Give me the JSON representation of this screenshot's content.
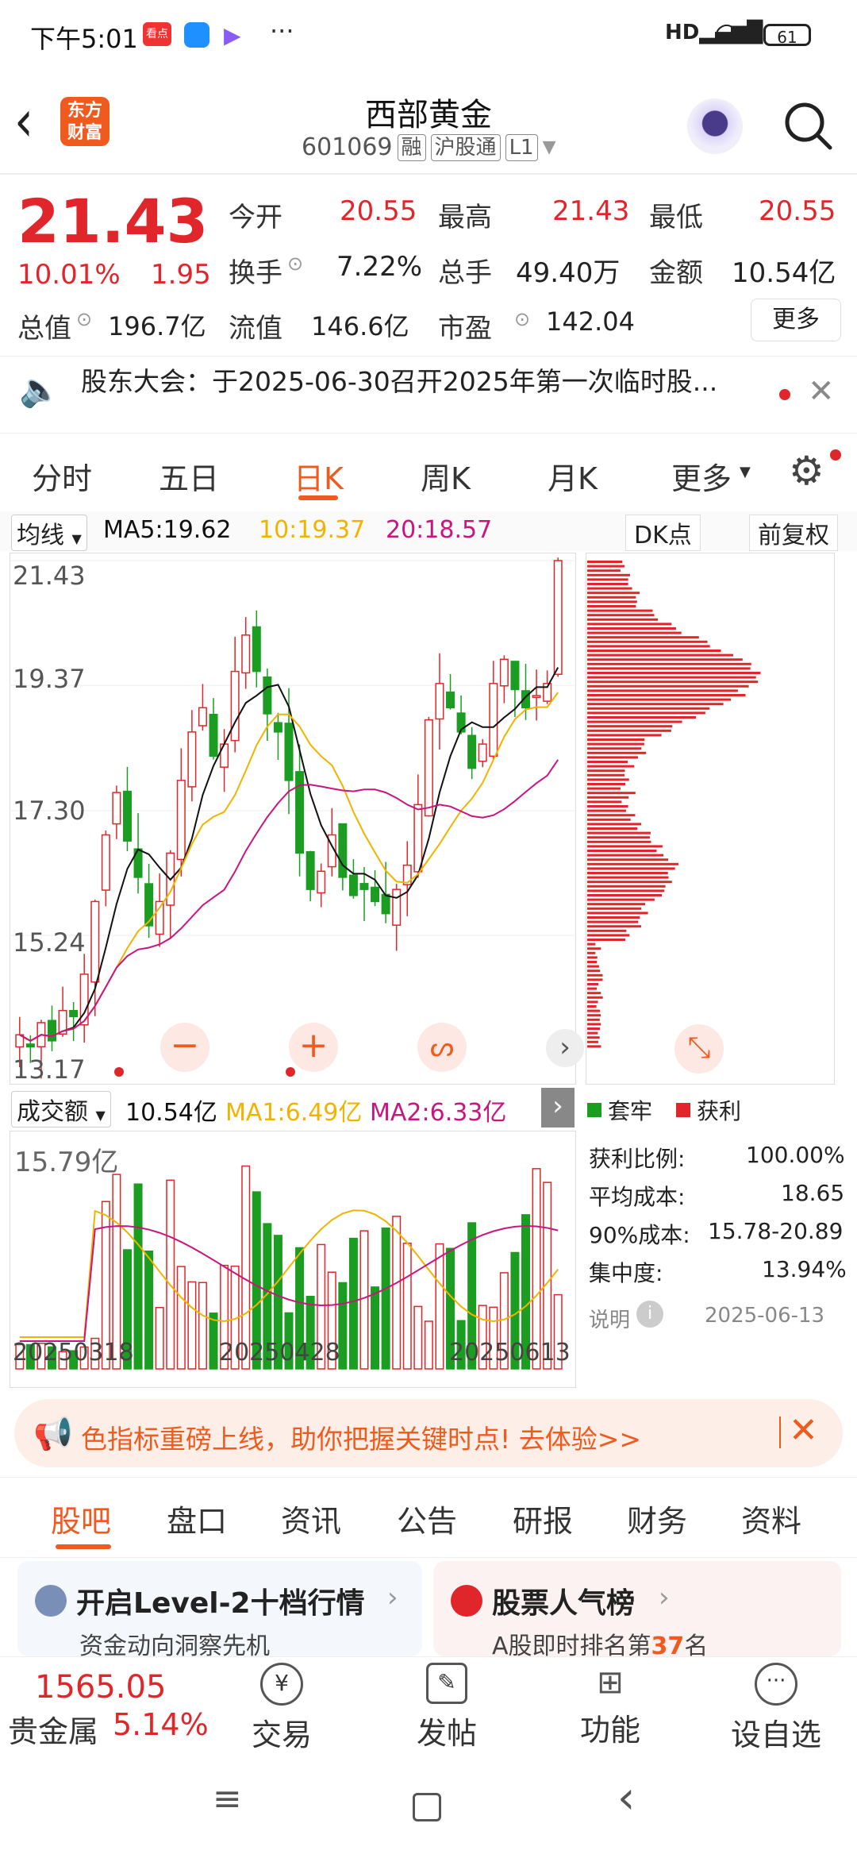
{
  "status_bar": {
    "time": "下午5:01",
    "app_badge": "看点",
    "battery": "61"
  },
  "header": {
    "logo_line1": "东方",
    "logo_line2": "财富",
    "title": "西部黄金",
    "code": "601069",
    "tags": [
      "融",
      "沪股通",
      "L1"
    ]
  },
  "quote": {
    "price": "21.43",
    "change_pct": "10.01%",
    "change": "1.95",
    "fields": [
      {
        "label": "今开",
        "value": "20.55"
      },
      {
        "label": "最高",
        "value": "21.43"
      },
      {
        "label": "最低",
        "value": "20.55"
      },
      {
        "label": "换手",
        "value": "7.22%"
      },
      {
        "label": "总手",
        "value": "49.40万"
      },
      {
        "label": "金额",
        "value": "10.54亿"
      },
      {
        "label": "总值",
        "value": "196.7亿"
      },
      {
        "label": "流值",
        "value": "146.6亿"
      },
      {
        "label": "市盈",
        "value": "142.04"
      }
    ],
    "more_button": "更多"
  },
  "notice": {
    "text": "股东大会：于2025-06-30召开2025年第一次临时股..."
  },
  "ktabs": [
    "分时",
    "五日",
    "日K",
    "周K",
    "月K",
    "更多"
  ],
  "active_ktab": "日K",
  "indicator": {
    "ma_select": "均线",
    "ma5": "MA5:19.62",
    "ma10": "10:19.37",
    "ma20": "20:18.57",
    "dk": "DK点",
    "adjust": "前复权"
  },
  "price_axis": [
    "21.43",
    "19.37",
    "17.30",
    "15.24",
    "13.17"
  ],
  "volume": {
    "select": "成交额",
    "amount": "10.54亿",
    "ma1": "MA1:6.49亿",
    "ma2": "MA2:6.33亿",
    "axis_max": "15.79亿"
  },
  "dates": [
    "20250318",
    "20250428",
    "20250613"
  ],
  "chip": {
    "legend_loss": "套牢",
    "legend_profit": "获利",
    "rows": [
      {
        "label": "获利比例:",
        "value": "100.00%"
      },
      {
        "label": "平均成本:",
        "value": "18.65"
      },
      {
        "label": "90%成本:",
        "value": "15.78-20.89"
      },
      {
        "label": "集中度:",
        "value": "13.94%"
      }
    ],
    "explain": "说明",
    "date": "2025-06-13"
  },
  "promo": {
    "text": "色指标重磅上线，助你把握关键时点! 去体验>>"
  },
  "bottom_tabs": [
    "股吧",
    "盘口",
    "资讯",
    "公告",
    "研报",
    "财务",
    "资料"
  ],
  "active_bottom_tab": "股吧",
  "cards": [
    {
      "title": "开启Level-2十档行情",
      "sub": "资金动向洞察先机"
    },
    {
      "title": "股票人气榜",
      "sub_prefix": "A股即时排名第",
      "rank": "37",
      "sub_suffix": "名"
    }
  ],
  "bottom_nav": {
    "index_value": "1565.05",
    "index_name": "贵金属",
    "index_pct": "5.14%",
    "items": [
      "交易",
      "发帖",
      "功能",
      "设自选"
    ]
  },
  "colors": {
    "up": "#e0262a",
    "down": "#1a9d20",
    "ma5": "#111111",
    "ma10": "#f0b400",
    "ma20": "#c8157f",
    "accent": "#ef5b1e"
  }
}
